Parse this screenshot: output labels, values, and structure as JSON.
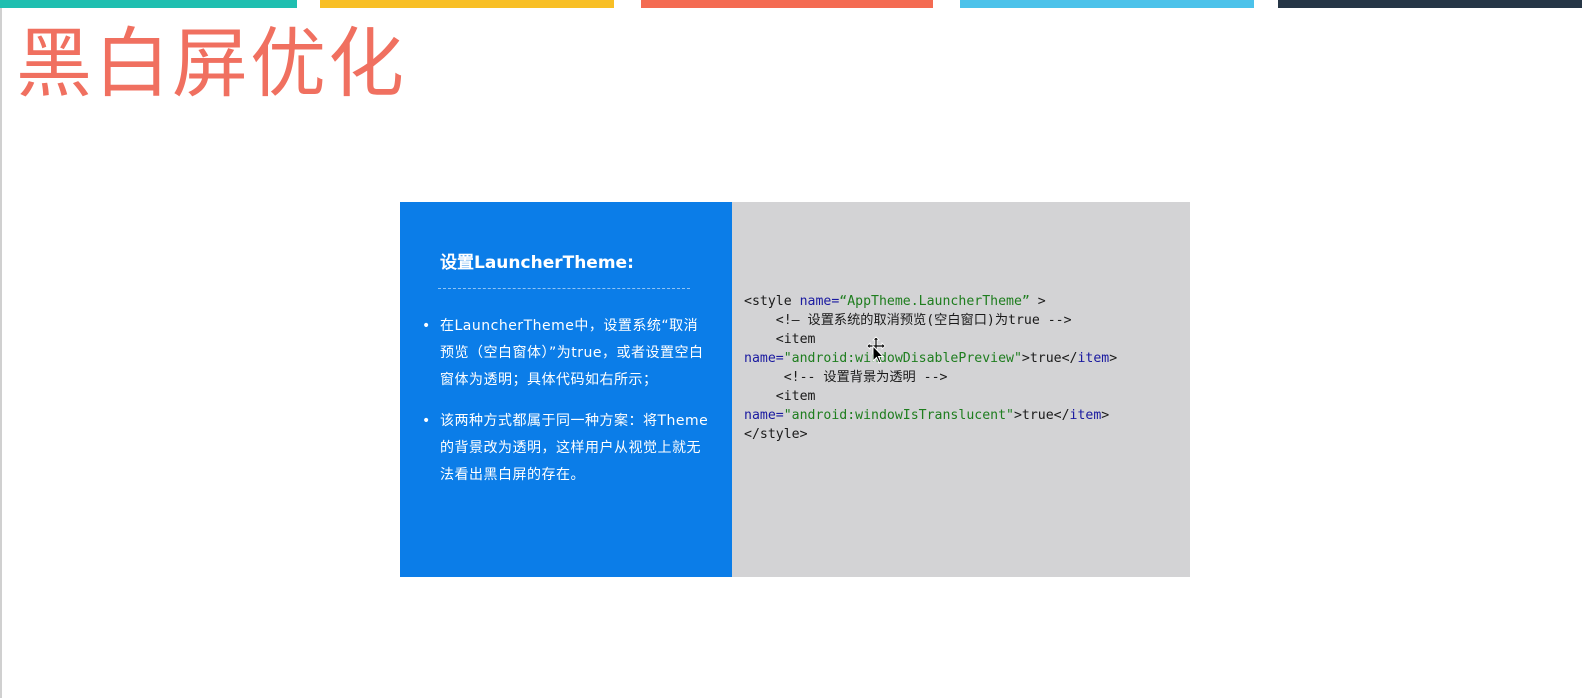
{
  "colors": {
    "bar_teal": "#1fbfb0",
    "bar_yellow": "#f8bf26",
    "bar_orange": "#f46b52",
    "bar_blue": "#4cc2ea",
    "bar_navy": "#263646",
    "title": "#f07060",
    "panel_blue": "#0b7de8",
    "code_bg": "#d3d3d5"
  },
  "title": "黑白屏优化",
  "panel": {
    "heading": "设置LauncherTheme:",
    "bullets": [
      "在LauncherTheme中，设置系统“取消预览（空白窗体）”为true，或者设置空白窗体为透明；具体代码如右所示；",
      "该两种方式都属于同一种方案：将Theme的背景改为透明，这样用户从视觉上就无法看出黑白屏的存在。"
    ]
  },
  "code": {
    "line1_open": "<style ",
    "line1_attr": "name=",
    "line1_value": "“AppTheme.LauncherTheme”",
    "line1_close": " >",
    "line2": "    <!— 设置系统的取消预览(空白窗口)为true -->",
    "line3": "    <item",
    "line4_attr": "name=",
    "line4_value": "\"android:windowDisablePreview\"",
    "line4_mid": ">true</",
    "line4_tag": "item",
    "line4_end": ">",
    "line5": "     <!-- 设置背景为透明 -->",
    "line6": "    <item",
    "line7_attr": "name=",
    "line7_value": "\"android:windowIsTranslucent\"",
    "line7_mid": ">true</",
    "line7_tag": "item",
    "line7_end": ">",
    "line8": "</style>"
  },
  "cursor": "move-cursor-icon"
}
